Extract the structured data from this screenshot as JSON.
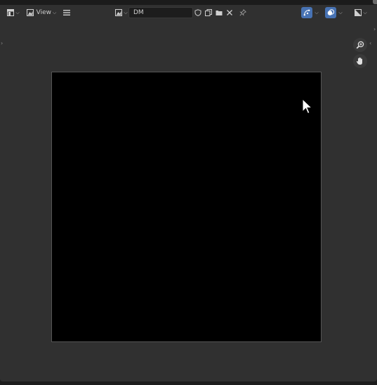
{
  "header": {
    "editor_type_icon": "image-editor-icon",
    "view_mode_icon": "image-view-icon",
    "view_menu_label": "View",
    "hamburger_icon": "hamburger-menu-icon",
    "image_browse_icon": "image-browse-icon",
    "image_name": "DM",
    "fake_user_icon": "shield-icon",
    "new_image_icon": "duplicate-icon",
    "open_image_icon": "folder-icon",
    "unlink_icon": "close-icon",
    "pin_icon": "pin-icon",
    "gizmo_icon": "gizmo-icon",
    "overlay_icon": "overlay-icon",
    "display_channels_icon": "display-channels-icon"
  },
  "tools": {
    "zoom_icon": "zoom-icon",
    "pan_icon": "hand-icon"
  },
  "canvas": {
    "image_color": "#000000"
  },
  "colors": {
    "accent": "#4772b3",
    "editor_bg": "#303030"
  }
}
